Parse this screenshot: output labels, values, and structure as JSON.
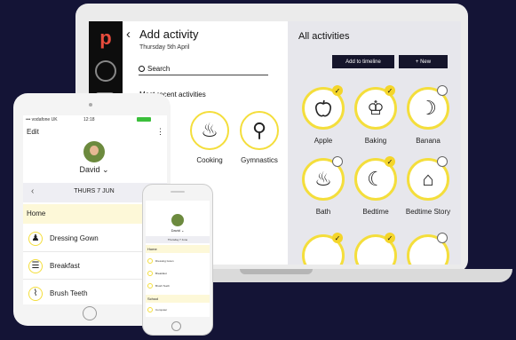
{
  "laptop": {
    "brand_glyph": "p",
    "header": {
      "back": "‹",
      "title": "Add activity",
      "date": "Thursday 5th April"
    },
    "search_label": "Search",
    "recent": {
      "heading": "Most recent activities",
      "items": [
        {
          "label": "Cooking",
          "icon": "cooking-pot-icon",
          "glyph": "♨"
        },
        {
          "label": "Gymnastics",
          "icon": "gymnast-icon",
          "glyph": "⚲"
        }
      ]
    },
    "panel": {
      "title": "All activities",
      "add_to_timeline": "Add to timeline",
      "new_button": "+ New",
      "activities": [
        {
          "label": "Apple",
          "icon": "apple-icon",
          "glyph": "",
          "checked": true
        },
        {
          "label": "Baking",
          "icon": "cupcake-icon",
          "glyph": "♔",
          "checked": true
        },
        {
          "label": "Banana",
          "icon": "banana-icon",
          "glyph": "☽",
          "checked": false
        },
        {
          "label": "Bath",
          "icon": "bathtub-icon",
          "glyph": "♨",
          "checked": false
        },
        {
          "label": "Bedtime",
          "icon": "bed-icon",
          "glyph": "☾",
          "checked": true
        },
        {
          "label": "Bedtime Story",
          "icon": "story-icon",
          "glyph": "⌂",
          "checked": false
        }
      ]
    }
  },
  "tablet": {
    "status": {
      "carrier": "••• vodafone UK",
      "time": "12:18"
    },
    "edit": "Edit",
    "more": "⋮",
    "profile_name": "David ⌄",
    "date": "THURS 7 JUN",
    "section": "Home",
    "items": [
      {
        "label": "Dressing Gown",
        "icon": "dressing-gown-icon",
        "glyph": "♟"
      },
      {
        "label": "Breakfast",
        "icon": "breakfast-icon",
        "glyph": "☰"
      },
      {
        "label": "Brush Teeth",
        "icon": "toothbrush-icon",
        "glyph": "⌇"
      }
    ]
  },
  "phone": {
    "profile_name": "David ⌄",
    "date": "Thursday 7 June",
    "section_home": "Home",
    "items": [
      {
        "label": "Dressing Gown"
      },
      {
        "label": "Breakfast"
      },
      {
        "label": "Brush Teeth"
      }
    ],
    "section_school": "School",
    "school_items": [
      {
        "label": "Computer"
      }
    ]
  },
  "colors": {
    "accent_yellow": "#f4de3c",
    "navy": "#15152b",
    "background": "#141436",
    "section_bg": "#fdf8d8"
  }
}
